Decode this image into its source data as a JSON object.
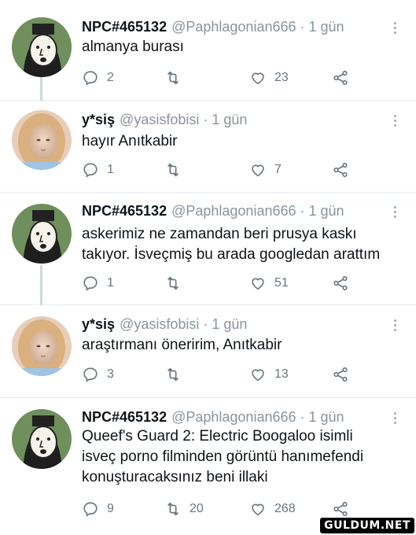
{
  "icons": {
    "reply": "reply-icon",
    "retweet": "retweet-icon",
    "like": "heart-icon",
    "share": "share-icon",
    "more": "more-icon"
  },
  "colors": {
    "text": "#0f1419",
    "meta": "#8a949c",
    "divider": "#e6ecf0",
    "thread_line": "#cfd9de"
  },
  "tweets": [
    {
      "name": "NPC#465132",
      "handle": "@Paphlagonian666",
      "time": "· 1 gün",
      "text": [
        "almanya burası"
      ],
      "replies": "2",
      "retweets": "",
      "likes": "23"
    },
    {
      "name": "y*siş",
      "handle": "@yasisfobisi",
      "time": "· 1 gün",
      "text": [
        "hayır Anıtkabir"
      ],
      "replies": "1",
      "retweets": "",
      "likes": "7"
    },
    {
      "name": "NPC#465132",
      "handle": "@Paphlagonian666",
      "time": "· 1 gün",
      "text": [
        "askerimiz ne zamandan beri prusya kaskı",
        "takıyor. İsveçmiş bu arada googledan arattım"
      ],
      "replies": "1",
      "retweets": "",
      "likes": "51"
    },
    {
      "name": "y*siş",
      "handle": "@yasisfobisi",
      "time": "· 1 gün",
      "text": [
        "araştırmanı öneririm, Anıtkabir"
      ],
      "replies": "3",
      "retweets": "",
      "likes": "13"
    },
    {
      "name": "NPC#465132",
      "handle": "@Paphlagonian666",
      "time": "· 1 gün",
      "text": [
        "Queef's Guard 2: Electric Boogaloo isimli",
        "isveç porno filminden görüntü hanımefendi",
        "konuşturacaksınız beni illaki"
      ],
      "replies": "9",
      "retweets": "20",
      "likes": "268"
    }
  ],
  "watermark": "GULDUM.NET"
}
